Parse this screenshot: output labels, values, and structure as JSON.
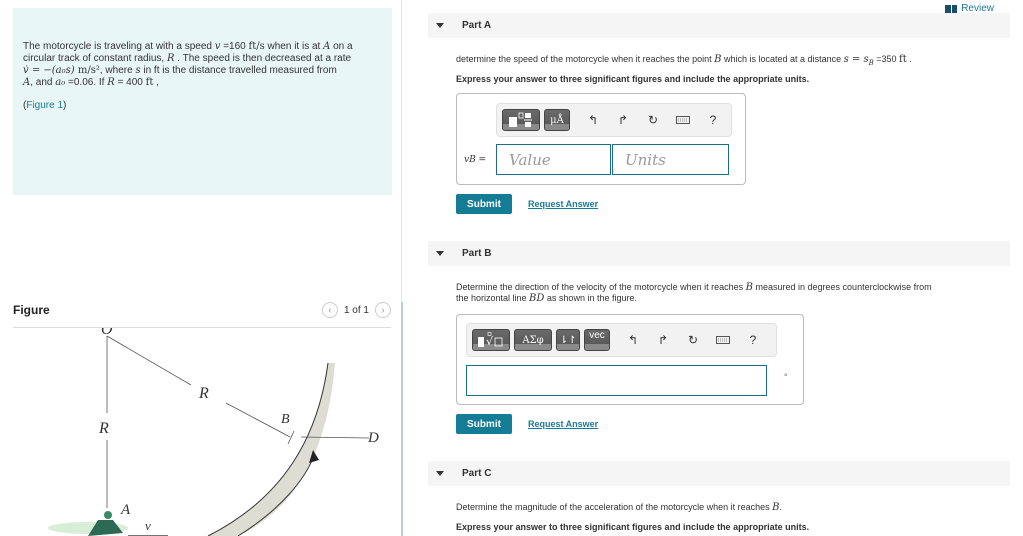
{
  "problem": {
    "line1_a": "The motorcycle is traveling at with a speed ",
    "v_sym": "v",
    "line1_b": " =160 ",
    "speed_unit": "ft/s",
    "line1_c": " when it is at ",
    "A_sym": "A",
    "line1_d": " on a",
    "line2_a": "circular track of constant radius, ",
    "R_sym": "R",
    "line2_b": " . The speed is then decreased at a rate",
    "vdot_expr": "v̇ = −(a₀s) ",
    "accel_unit": "m/s²",
    "line3_b": ", where ",
    "s_sym": "s",
    "line3_c": "  in ft  is the distance travelled measured from",
    "line4_a": ", and ",
    "a0_sym": "a₀",
    "line4_b": " =0.06.  If  ",
    "R_eq": "R",
    "line4_c": " = 400 ",
    "radius_unit": "ft",
    "line4_d": " ,",
    "figure_link_open": "(",
    "figure_link": "Figure 1",
    "figure_link_close": ")"
  },
  "figure": {
    "title": "Figure",
    "pager": "1 of 1",
    "prev_icon": "‹",
    "next_icon": "›",
    "labels": {
      "O": "O",
      "R1": "R",
      "R2": "R",
      "B": "B",
      "D": "D",
      "A": "A",
      "v": "v"
    }
  },
  "review": {
    "label": "Review"
  },
  "partA": {
    "title": "Part A",
    "q_a": "determine the speed of the motorcycle when it reaches the point ",
    "B_sym": "B",
    "q_b": " which is located at a distance ",
    "s_expr": "s = s",
    "sub_B": "B",
    "q_c": " =350 ",
    "dist_unit": "ft",
    "q_d": " .",
    "instruction": "Express your answer to three significant figures and include the appropriate units.",
    "var_label": "vB =",
    "value_placeholder": "Value",
    "units_placeholder": "Units",
    "toolbar": {
      "units_btn": "μÅ",
      "help": "?"
    },
    "submit": "Submit",
    "request": "Request Answer"
  },
  "partB": {
    "title": "Part B",
    "q_a": "Determine the direction of the velocity of the motorcycle when it reaches ",
    "B_sym": "B",
    "q_b": " measured in degrees counterclockwise from",
    "q_c": "the horizontal line ",
    "BD_sym": "BD",
    "q_d": " as shown in the figure.",
    "toolbar": {
      "greek_btn": "ΑΣφ",
      "arrows_btn": "⇂↾",
      "vec_btn": "vec",
      "help": "?"
    },
    "answer_value": "",
    "degree_unit": "°",
    "submit": "Submit",
    "request": "Request Answer"
  },
  "partC": {
    "title": "Part C",
    "q_a": "Determine the magnitude of the acceleration of the motorcycle when it reaches ",
    "B_sym": "B",
    "q_b": ".",
    "instruction": "Express your answer to three significant figures and include the appropriate units."
  }
}
